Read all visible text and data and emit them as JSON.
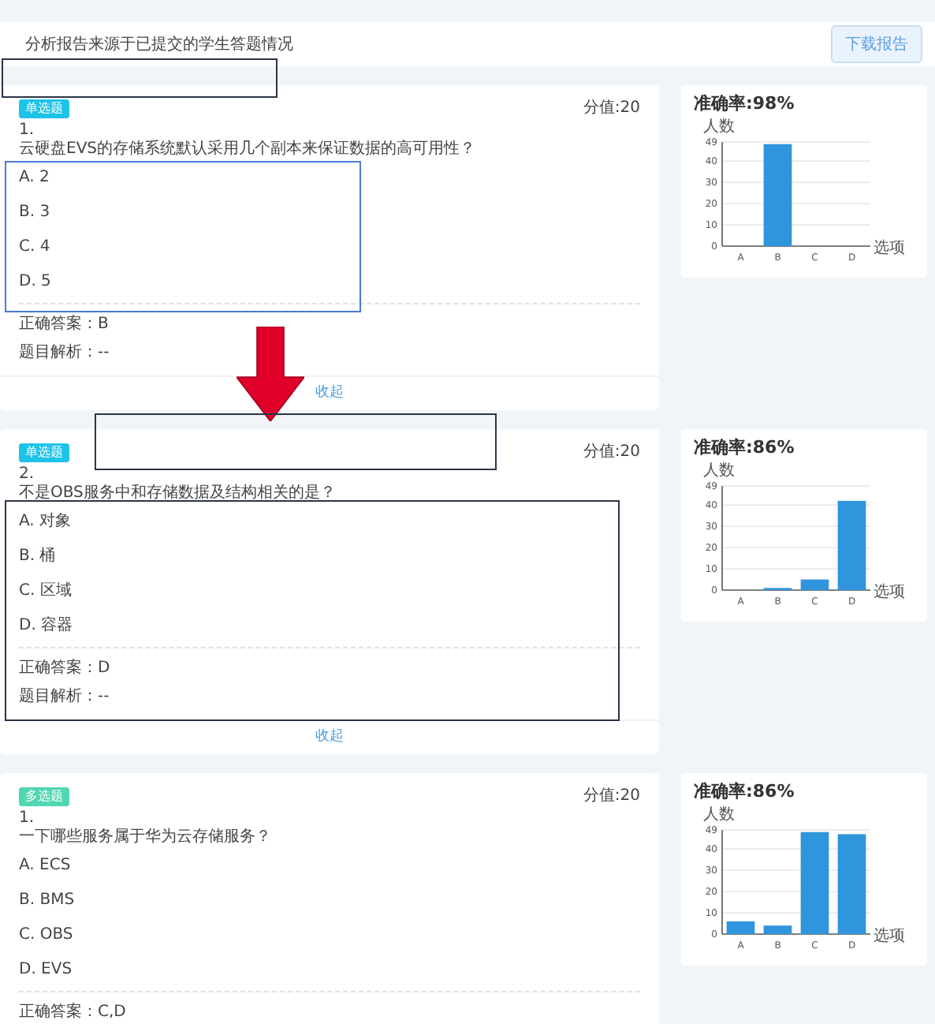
{
  "header": {
    "notice": "分析报告来源于已提交的学生答题情况",
    "download_button": "下载报告"
  },
  "questions": [
    {
      "tag": {
        "text": "单选题",
        "color": "#1ec3e8"
      },
      "score": "分值:20",
      "number": "1.",
      "text": "云硬盘EVS的存储系统默认采用几个副本来保证数据的高可用性？",
      "options": [
        "A. 2",
        "B. 3",
        "C. 4",
        "D. 5"
      ],
      "answer": "正确答案：B",
      "analysis": "题目解析：--",
      "collapse_link": "收起",
      "accuracy": "准确率:98%",
      "chart_data": {
        "type": "bar",
        "ylabel": "人数",
        "xlabel": "选项",
        "categories": [
          "A",
          "B",
          "C",
          "D"
        ],
        "values": [
          0,
          48,
          0,
          0
        ],
        "grid": true,
        "ylim": [
          0,
          49
        ],
        "yticks": [
          0,
          10,
          20,
          30,
          40,
          49
        ]
      }
    },
    {
      "tag": {
        "text": "单选题",
        "color": "#1ec3e8"
      },
      "score": "分值:20",
      "number": "2.",
      "text": "不是OBS服务中和存储数据及结构相关的是？",
      "options": [
        "A. 对象",
        "B. 桶",
        "C. 区域",
        "D. 容器"
      ],
      "answer": "正确答案：D",
      "analysis": "题目解析：--",
      "collapse_link": "收起",
      "accuracy": "准确率:86%",
      "chart_data": {
        "type": "bar",
        "ylabel": "人数",
        "xlabel": "选项",
        "categories": [
          "A",
          "B",
          "C",
          "D"
        ],
        "values": [
          0,
          1,
          5,
          42
        ],
        "grid": true,
        "ylim": [
          0,
          49
        ],
        "yticks": [
          0,
          10,
          20,
          30,
          40,
          49
        ]
      }
    },
    {
      "tag": {
        "text": "多选题",
        "color": "#4fd6b2"
      },
      "score": "分值:20",
      "number": "1.",
      "text": "一下哪些服务属于华为云存储服务？",
      "options": [
        "A. ECS",
        "B. BMS",
        "C. OBS",
        "D. EVS"
      ],
      "answer": "正确答案：C,D",
      "accuracy": "准确率:86%",
      "chart_data": {
        "type": "bar",
        "ylabel": "人数",
        "xlabel": "选项",
        "categories": [
          "A",
          "B",
          "C",
          "D"
        ],
        "values": [
          6,
          4,
          48,
          47
        ],
        "grid": true,
        "ylim": [
          0,
          49
        ],
        "yticks": [
          0,
          10,
          20,
          30,
          40,
          49
        ]
      }
    }
  ],
  "annotations": [
    {
      "kind": "frame",
      "color": "#2b3448"
    },
    {
      "kind": "frame",
      "color": "#4a7bd8"
    },
    {
      "kind": "arrow",
      "color": "#e0002a"
    },
    {
      "kind": "frame",
      "color": "#2b3448"
    },
    {
      "kind": "frame",
      "color": "#2b3448"
    }
  ]
}
